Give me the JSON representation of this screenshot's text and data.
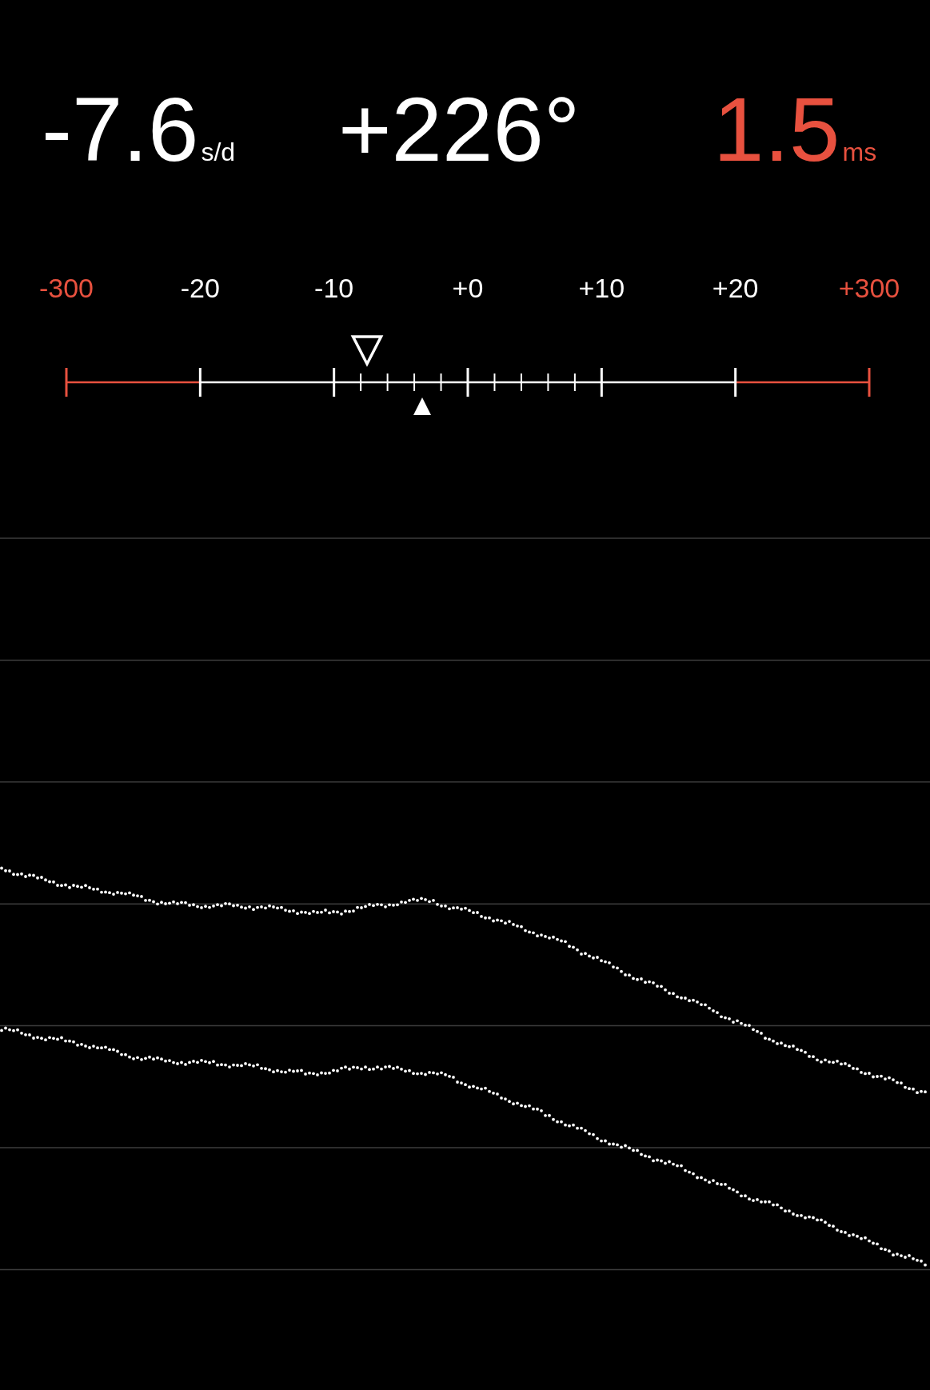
{
  "readings": [
    {
      "value": "-7.6",
      "unit": "s/d",
      "color": "#ffffff"
    },
    {
      "value": "+226°",
      "color": "#ffffff"
    },
    {
      "value": "1.5",
      "unit": "ms",
      "color": "#e8513f"
    }
  ],
  "scale": {
    "labels": [
      {
        "text": "-300",
        "color": "#e8513f"
      },
      {
        "text": "-20",
        "color": "#ffffff"
      },
      {
        "text": "-10",
        "color": "#ffffff"
      },
      {
        "text": "+0",
        "color": "#ffffff"
      },
      {
        "text": "+10",
        "color": "#ffffff"
      },
      {
        "text": "+20",
        "color": "#ffffff"
      },
      {
        "text": "+300",
        "color": "#e8513f"
      }
    ],
    "markers": [
      {
        "kind": "hollow",
        "level": 0.3745
      },
      {
        "kind": "solid",
        "level": 0.4432
      }
    ]
  }
}
